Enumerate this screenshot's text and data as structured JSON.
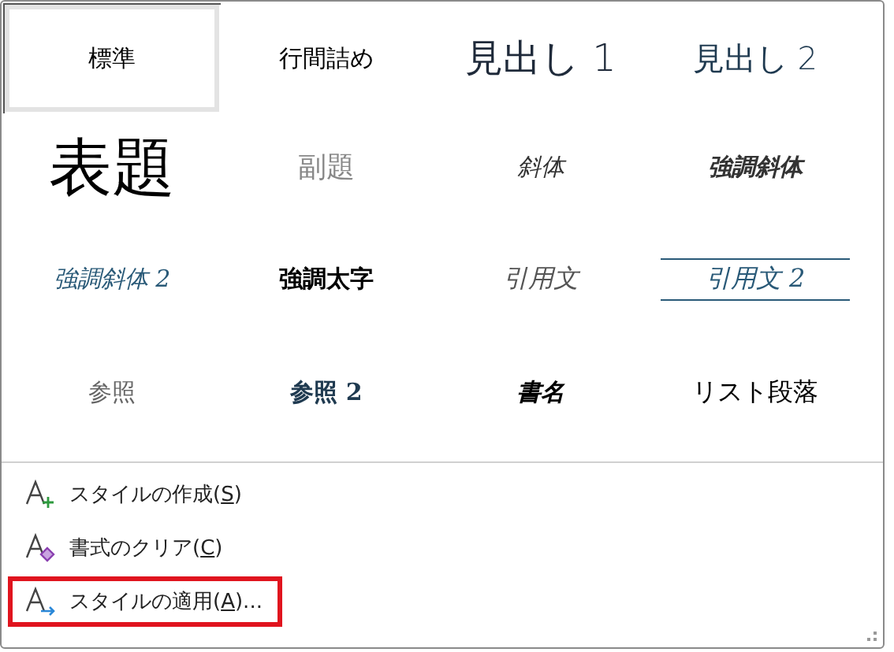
{
  "styles": [
    {
      "label": "標準",
      "kind": "normal",
      "selected": true
    },
    {
      "label": "行間詰め",
      "kind": "no-spacing",
      "selected": false
    },
    {
      "label": "見出し 1",
      "kind": "heading1",
      "selected": false
    },
    {
      "label": "見出し 2",
      "kind": "heading2",
      "selected": false
    },
    {
      "label": "表題",
      "kind": "title",
      "selected": false
    },
    {
      "label": "副題",
      "kind": "subtitle",
      "selected": false
    },
    {
      "label": "斜体",
      "kind": "emphasis",
      "selected": false
    },
    {
      "label": "強調斜体",
      "kind": "intense-emphasis",
      "selected": false
    },
    {
      "label": "強調斜体 2",
      "kind": "intense-emphasis-2",
      "selected": false
    },
    {
      "label": "強調太字",
      "kind": "strong",
      "selected": false
    },
    {
      "label": "引用文",
      "kind": "quote",
      "selected": false
    },
    {
      "label": "引用文 2",
      "kind": "intense-quote",
      "selected": false
    },
    {
      "label": "参照",
      "kind": "reference",
      "selected": false
    },
    {
      "label": "参照 2",
      "kind": "intense-reference",
      "selected": false
    },
    {
      "label": "書名",
      "kind": "book-title",
      "selected": false
    },
    {
      "label": "リスト段落",
      "kind": "list-paragraph",
      "selected": false
    }
  ],
  "menu": [
    {
      "kind": "create",
      "before": "スタイルの作成(",
      "key": "S",
      "after": ")",
      "highlighted": false
    },
    {
      "kind": "clear",
      "before": "書式のクリア(",
      "key": "C",
      "after": ")",
      "highlighted": false
    },
    {
      "kind": "apply",
      "before": "スタイルの適用(",
      "key": "A",
      "after": ")...",
      "highlighted": true
    }
  ]
}
